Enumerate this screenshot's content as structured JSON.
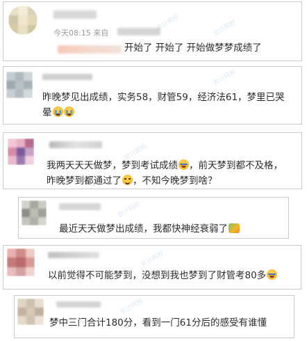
{
  "comments": [
    {
      "meta_time": "今天08:15",
      "meta_from": "来自",
      "text_lines": [
        "开始了 开始了 开始做梦梦成绩了"
      ],
      "emojis": []
    },
    {
      "text_lines": [
        "昨晚梦见出成绩，实务58，财管59，经济法61，梦里已哭",
        "晕"
      ],
      "emojis": [
        "cry-emoji",
        "cry-emoji"
      ]
    },
    {
      "text_lines": [
        "我两天天天做梦，梦到考试成绩",
        "，前天梦到都不及格，",
        "昨晚梦到都通过了",
        "，不知今晚梦到啥？"
      ],
      "emojis": [
        "laugh-emoji",
        "smirk-emoji"
      ]
    },
    {
      "text_lines": [
        "最近天天做梦出成绩，我都快神经衰弱了"
      ],
      "emojis": [
        "weak-emoji"
      ]
    },
    {
      "text_lines": [
        "以前觉得不可能梦到，没想到我也梦到了财管考80多"
      ],
      "emojis": [
        "laugh-emoji"
      ]
    },
    {
      "text_lines": [
        "梦中三门合计180分，看到一门61分后的感受有谁懂"
      ],
      "emojis": []
    }
  ],
  "colors": {
    "card_border": "#c9c9c9",
    "text": "#2b2b2b",
    "meta": "#9a9a9a"
  }
}
